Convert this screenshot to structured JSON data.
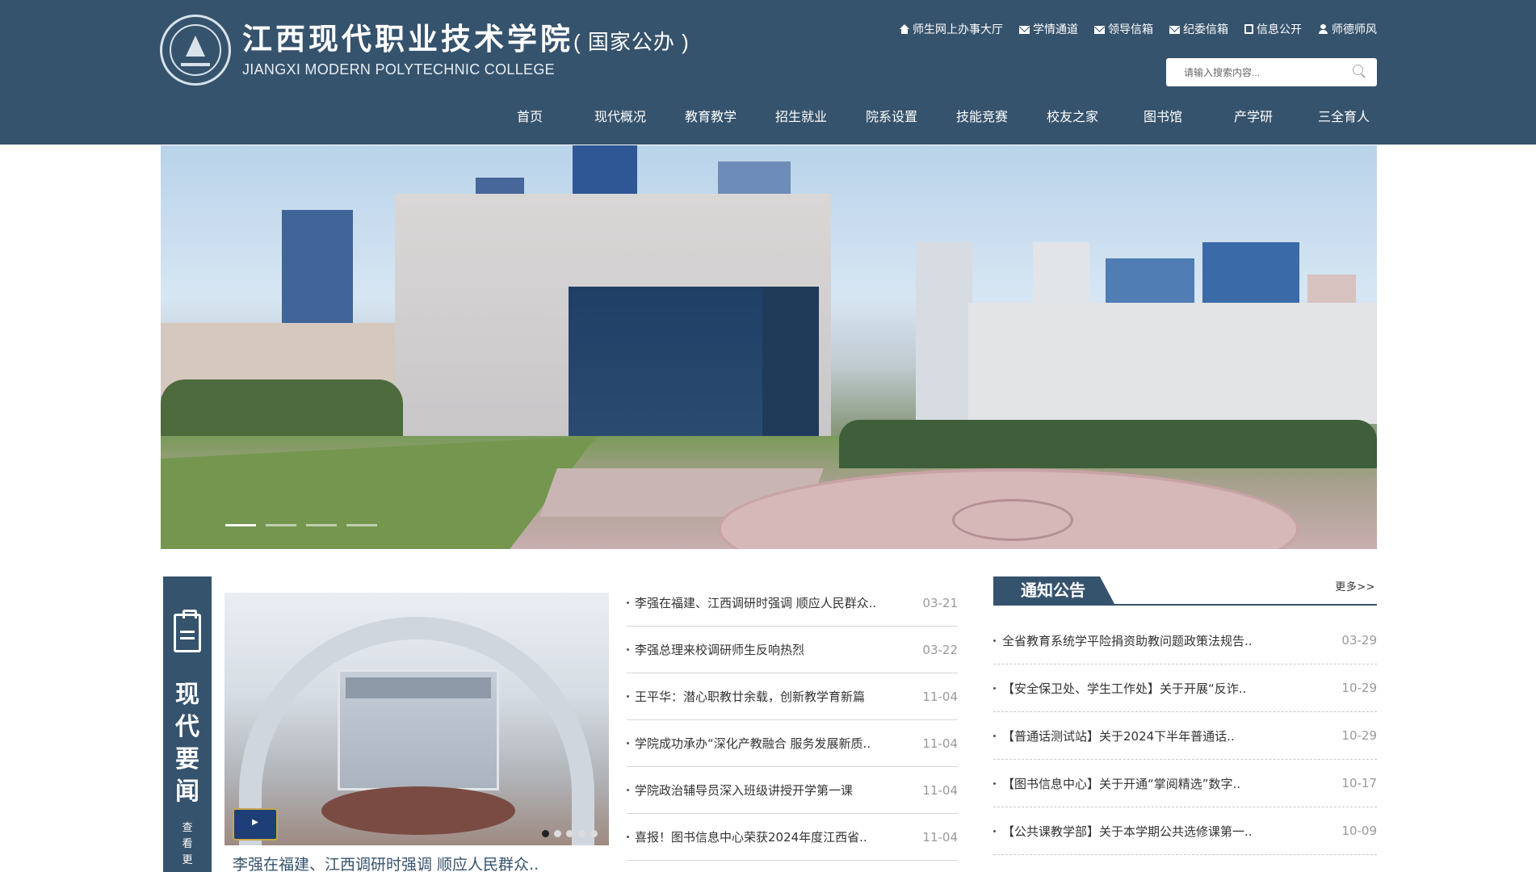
{
  "header": {
    "college_cn": "江西现代职业技术学院",
    "college_pub": "( 国家公办 )",
    "college_en": "JIANGXI MODERN POLYTECHNIC COLLEGE",
    "top_links": [
      {
        "label": "师生网上办事大厅",
        "icon": "home-icon"
      },
      {
        "label": "学情通道",
        "icon": "mail-icon"
      },
      {
        "label": "领导信箱",
        "icon": "mail-icon"
      },
      {
        "label": "纪委信箱",
        "icon": "mail-icon"
      },
      {
        "label": "信息公开",
        "icon": "document-icon"
      },
      {
        "label": "师德师风",
        "icon": "user-icon"
      }
    ],
    "search_placeholder": "请输入搜索内容..."
  },
  "nav": [
    "首页",
    "现代概况",
    "教育教学",
    "招生就业",
    "院系设置",
    "技能竞赛",
    "校友之家",
    "图书馆",
    "产学研",
    "三全育人"
  ],
  "news": {
    "section_title": "现代要闻",
    "more_vertical": "查看更",
    "featured_caption": "李强在福建、江西调研时强调 顺应人民群众..",
    "items": [
      {
        "title": "李强在福建、江西调研时强调 顺应人民群众..",
        "date": "03-21"
      },
      {
        "title": "李强总理来校调研师生反响热烈",
        "date": "03-22"
      },
      {
        "title": "王平华：潜心职教廿余载，创新教学育新篇",
        "date": "11-04"
      },
      {
        "title": "学院成功承办“深化产教融合 服务发展新质..",
        "date": "11-04"
      },
      {
        "title": "学院政治辅导员深入班级讲授开学第一课",
        "date": "11-04"
      },
      {
        "title": "喜报！图书信息中心荣获2024年度江西省..",
        "date": "11-04"
      }
    ]
  },
  "notice": {
    "title": "通知公告",
    "more": "更多>>",
    "items": [
      {
        "title": "全省教育系统学平险捐资助教问题政策法规告..",
        "date": "03-29"
      },
      {
        "title": "【安全保卫处、学生工作处】关于开展“反诈..",
        "date": "10-29"
      },
      {
        "title": "【普通话测试站】关于2024下半年普通话..",
        "date": "10-29"
      },
      {
        "title": "【图书信息中心】关于开通“掌阅精选”数字..",
        "date": "10-17"
      },
      {
        "title": "【公共课教学部】关于本学期公共选修课第一..",
        "date": "10-09"
      }
    ]
  }
}
